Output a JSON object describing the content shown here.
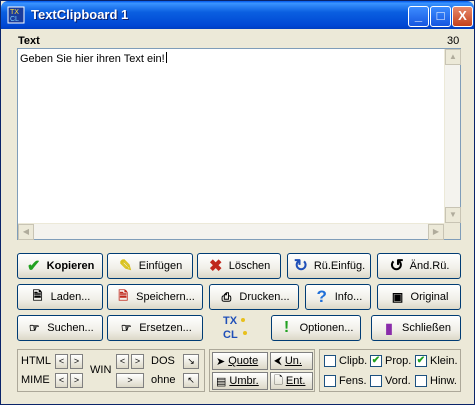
{
  "window": {
    "title": "TextClipboard 1"
  },
  "titlebar_buttons": {
    "minimize": "_",
    "maximize": "□",
    "close": "X"
  },
  "editor": {
    "label": "Text",
    "counter": "30",
    "content": "Geben Sie hier ihren Text ein!"
  },
  "row1": [
    {
      "label": "Kopieren",
      "icon": "check-icon"
    },
    {
      "label": "Einfügen",
      "icon": "paste-icon"
    },
    {
      "label": "Löschen",
      "icon": "delete-icon"
    },
    {
      "label": "Rü.Einfüg.",
      "icon": "undo-icon"
    },
    {
      "label": "Änd.Rü.",
      "icon": "redo-icon"
    }
  ],
  "row2": [
    {
      "label": "Laden...",
      "icon": "open-file-icon"
    },
    {
      "label": "Speichern...",
      "icon": "save-file-icon"
    },
    {
      "label": "Drucken...",
      "icon": "print-icon"
    },
    {
      "label": "Info...",
      "icon": "help-icon"
    },
    {
      "label": "Original",
      "icon": "original-icon"
    }
  ],
  "row3": [
    {
      "label": "Suchen...",
      "icon": "search-icon"
    },
    {
      "label": "Ersetzen...",
      "icon": "replace-icon"
    },
    {
      "label": "Optionen...",
      "icon": "options-icon"
    },
    {
      "label": "Schließen",
      "icon": "exit-icon"
    }
  ],
  "conversion": {
    "html": "HTML",
    "mime": "MIME",
    "win": "WIN",
    "dos": "DOS",
    "ohne": "ohne",
    "left_arrow": "<",
    "right_arrow": ">"
  },
  "format_buttons": [
    {
      "label": "Quote",
      "icon": "quote-icon"
    },
    {
      "label": "Un.",
      "icon": "unquote-icon"
    },
    {
      "label": "Umbr.",
      "icon": "wrap-icon"
    },
    {
      "label": "Ent.",
      "icon": "unwrap-icon"
    }
  ],
  "checkboxes": [
    {
      "label": "Clipb.",
      "checked": false
    },
    {
      "label": "Prop.",
      "checked": true
    },
    {
      "label": "Klein.",
      "checked": true
    },
    {
      "label": "Fens.",
      "checked": false
    },
    {
      "label": "Vord.",
      "checked": false
    },
    {
      "label": "Hinw.",
      "checked": false
    }
  ],
  "colors": {
    "titlebar": "#0058ee",
    "face": "#ece9d8",
    "accent_green": "#21a121",
    "accent_red": "#c0281c",
    "accent_blue": "#1f4fb8"
  }
}
